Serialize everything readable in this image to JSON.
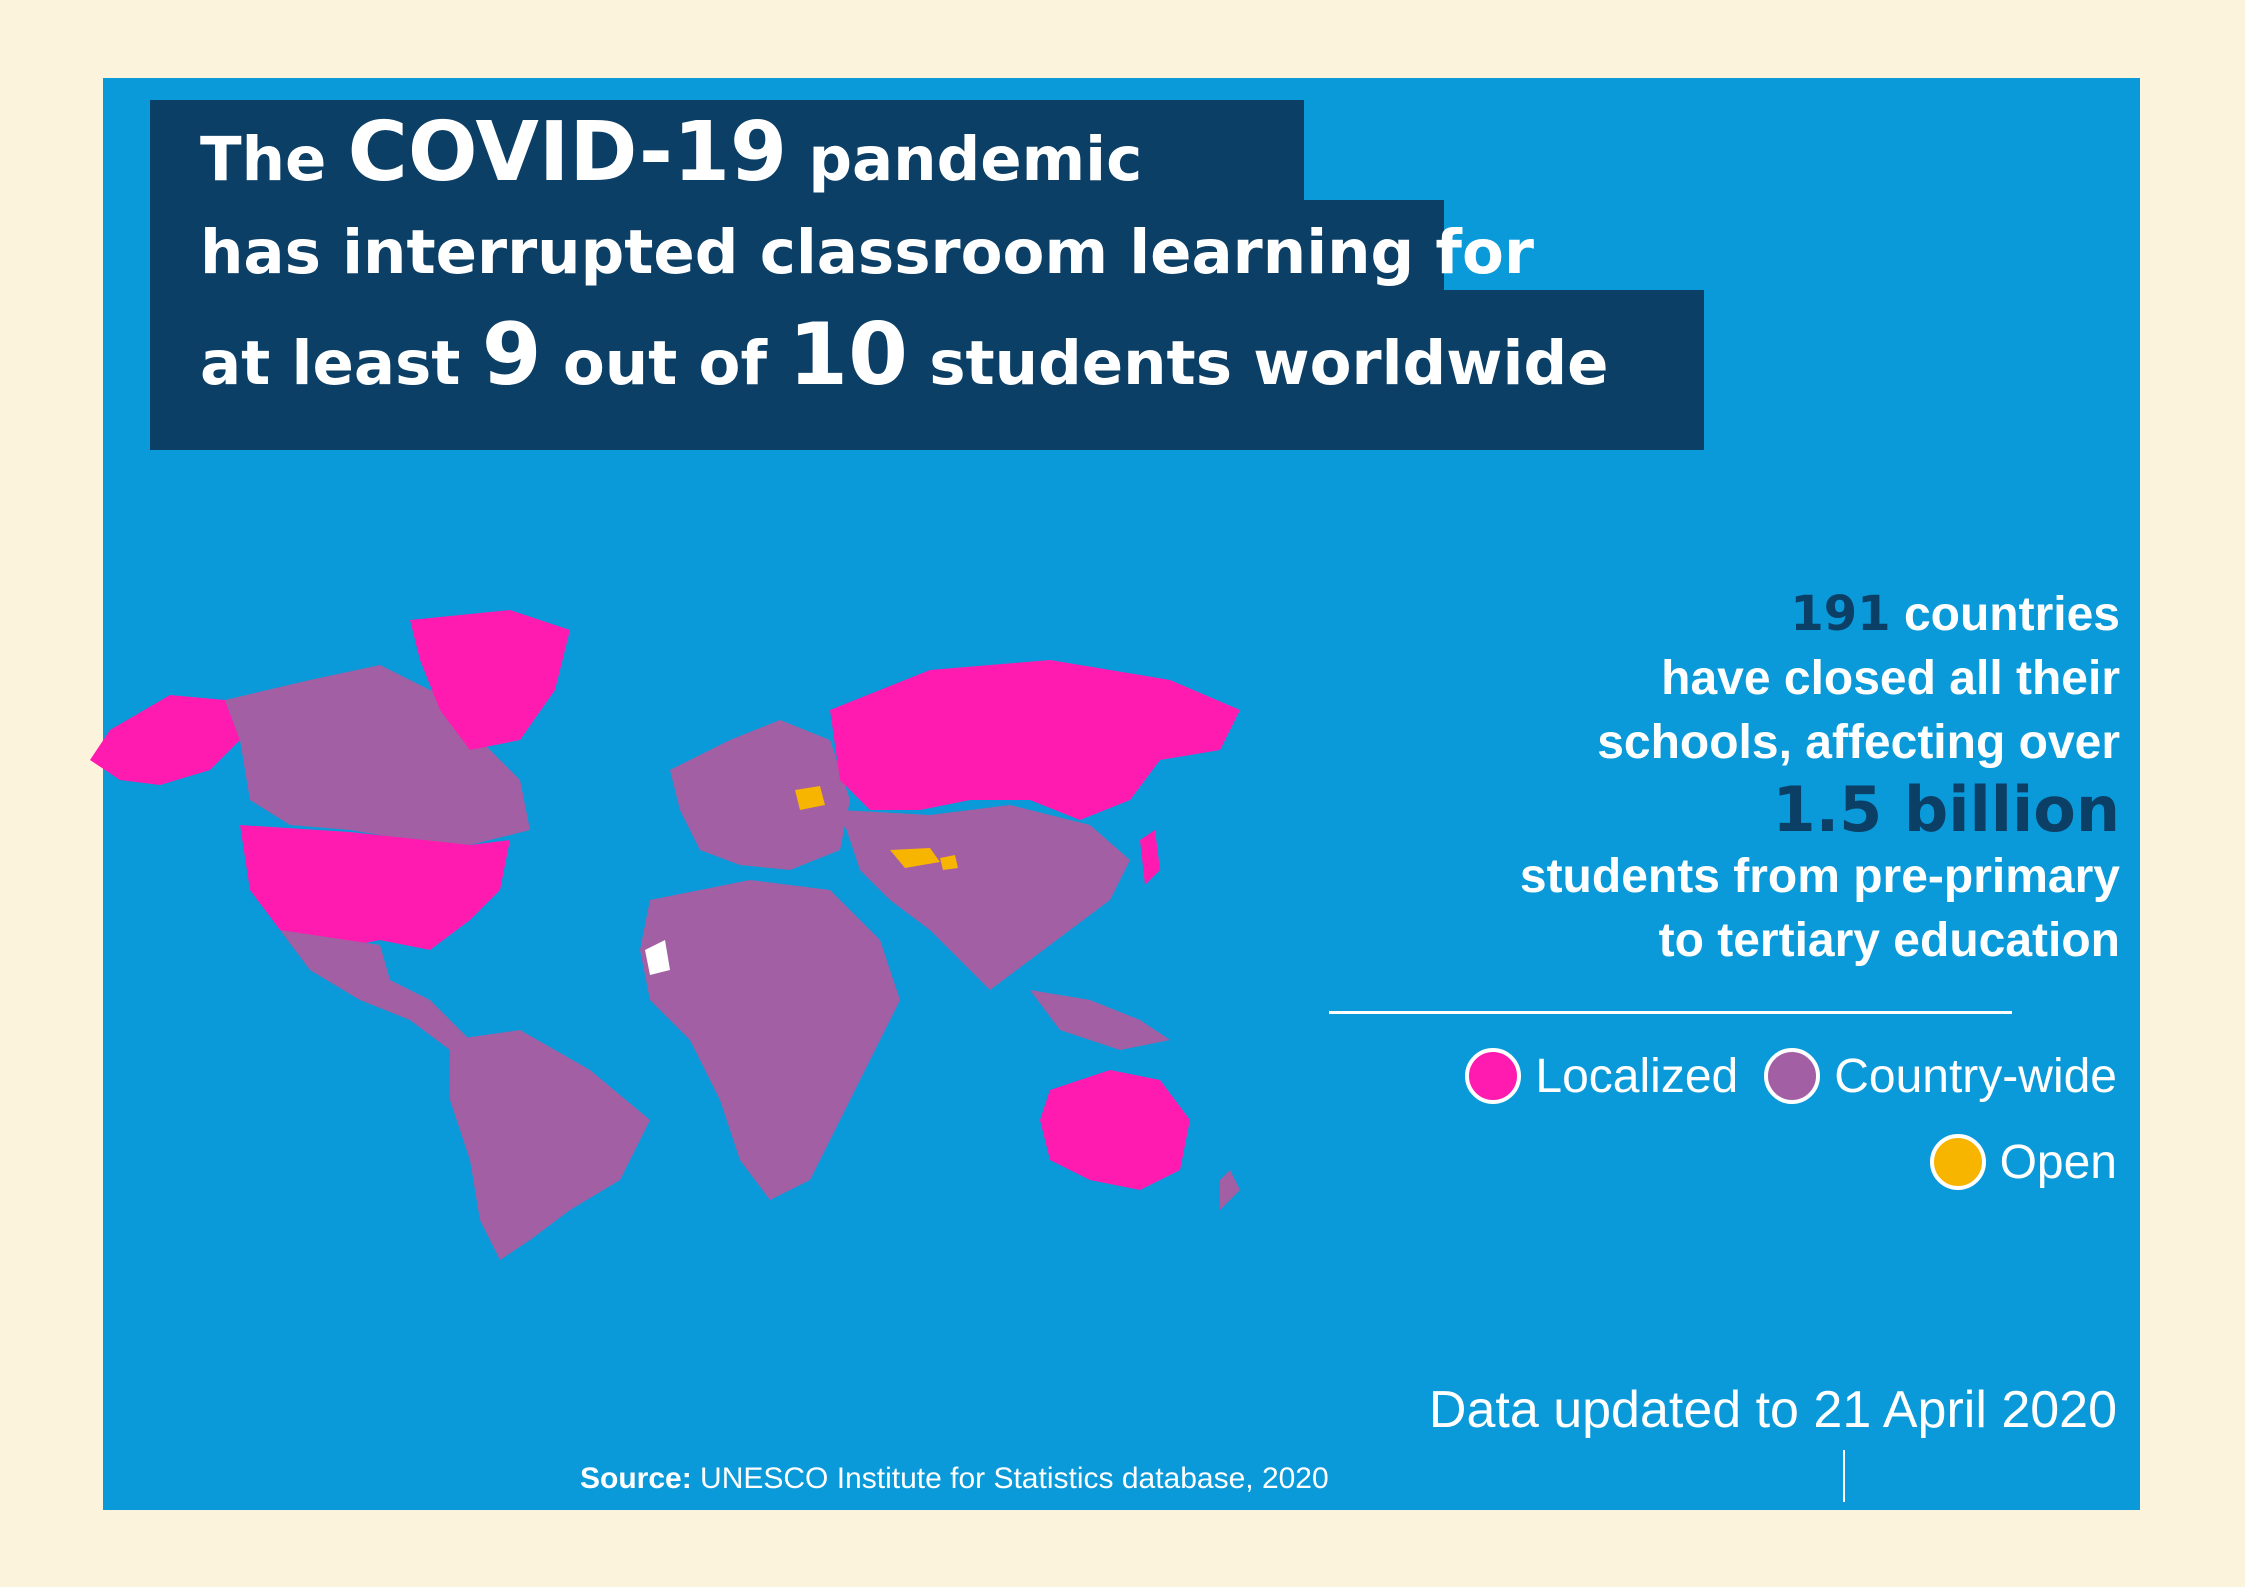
{
  "title": {
    "line1": {
      "pre": "The",
      "emph": "COVID-19",
      "post": "pandemic"
    },
    "line2": "has interrupted classroom learning for",
    "line3": {
      "pre": "at least",
      "num1": "9",
      "mid": "out of",
      "num2": "10",
      "post": "students worldwide"
    }
  },
  "stats": {
    "count": "191",
    "count_text": "countries",
    "line2": "have closed all their",
    "line3": "schools,  affecting over",
    "amount": "1.5 billion",
    "line5": "students from pre-primary",
    "line6": "to tertiary education"
  },
  "legend": {
    "items": [
      {
        "label": "Localized",
        "color": "#ff1ab0"
      },
      {
        "label": "Country-wide",
        "color": "#a35fa3"
      },
      {
        "label": "Open",
        "color": "#f7b500"
      }
    ]
  },
  "colors": {
    "background": "#fbf3dc",
    "card": "#0a9ad9",
    "title_bg": "#0b3f66",
    "localized": "#ff1ab0",
    "country_wide": "#a35fa3",
    "open": "#f7b500"
  },
  "map_status": {
    "localized": [
      "United States",
      "Russia",
      "Australia",
      "Greenland",
      "Alaska"
    ],
    "open": [
      "Belarus",
      "Turkmenistan",
      "Tajikistan"
    ]
  },
  "updated": "Data updated to 21 April 2020",
  "source": {
    "label": "Source:",
    "text": " UNESCO Institute for Statistics database, 2020"
  }
}
